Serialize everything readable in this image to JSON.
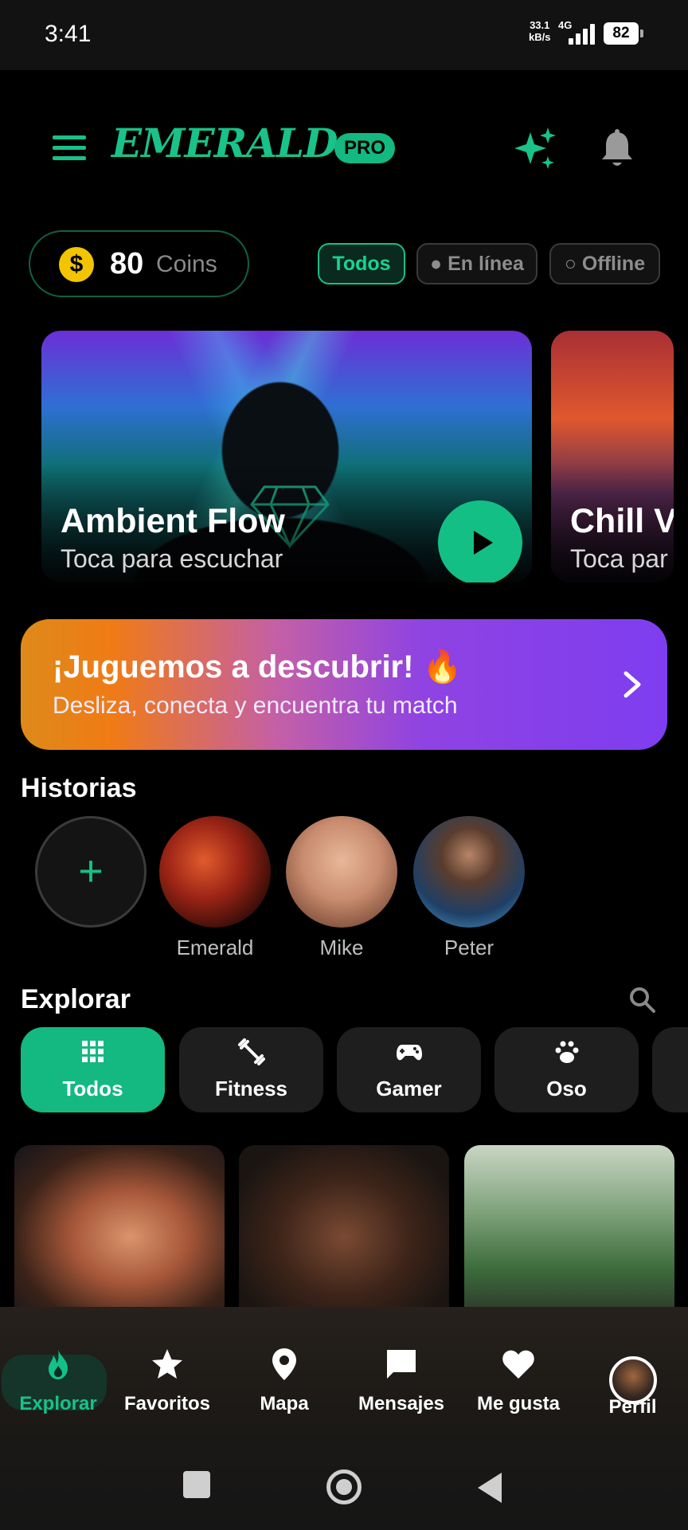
{
  "status_bar": {
    "time": "3:41",
    "net_speed": "33.1",
    "net_unit": "kB/s",
    "net_type": "4G",
    "battery": "82"
  },
  "header": {
    "logo": "EMERALD",
    "badge": "PRO"
  },
  "coins": {
    "value": "80",
    "label": "Coins"
  },
  "filters": {
    "all": "Todos",
    "online": "● En línea",
    "offline": "○ Offline"
  },
  "cards": [
    {
      "title": "Ambient Flow",
      "subtitle": "Toca para escuchar"
    },
    {
      "title": "Chill Vi",
      "subtitle": "Toca par"
    }
  ],
  "promo": {
    "title": "¡Juguemos a descubrir! 🔥",
    "subtitle": "Desliza, conecta y encuentra tu match"
  },
  "stories": {
    "title": "Historias",
    "add": "+",
    "items": [
      {
        "name": "Emerald"
      },
      {
        "name": "Mike"
      },
      {
        "name": "Peter"
      }
    ]
  },
  "explore": {
    "title": "Explorar",
    "categories": [
      {
        "label": "Todos",
        "icon": "grid-icon"
      },
      {
        "label": "Fitness",
        "icon": "dumbbell-icon"
      },
      {
        "label": "Gamer",
        "icon": "gamepad-icon"
      },
      {
        "label": "Oso",
        "icon": "paw-icon"
      }
    ]
  },
  "nav": [
    {
      "label": "Explorar",
      "icon": "flame-icon"
    },
    {
      "label": "Favoritos",
      "icon": "star-icon"
    },
    {
      "label": "Mapa",
      "icon": "map-pin-icon"
    },
    {
      "label": "Mensajes",
      "icon": "chat-icon"
    },
    {
      "label": "Me gusta",
      "icon": "heart-icon"
    },
    {
      "label": "Perfil",
      "icon": "avatar"
    }
  ],
  "colors": {
    "accent": "#13b981",
    "background": "#000000",
    "promo_start": "#f07b15",
    "promo_end": "#7e3df0"
  }
}
